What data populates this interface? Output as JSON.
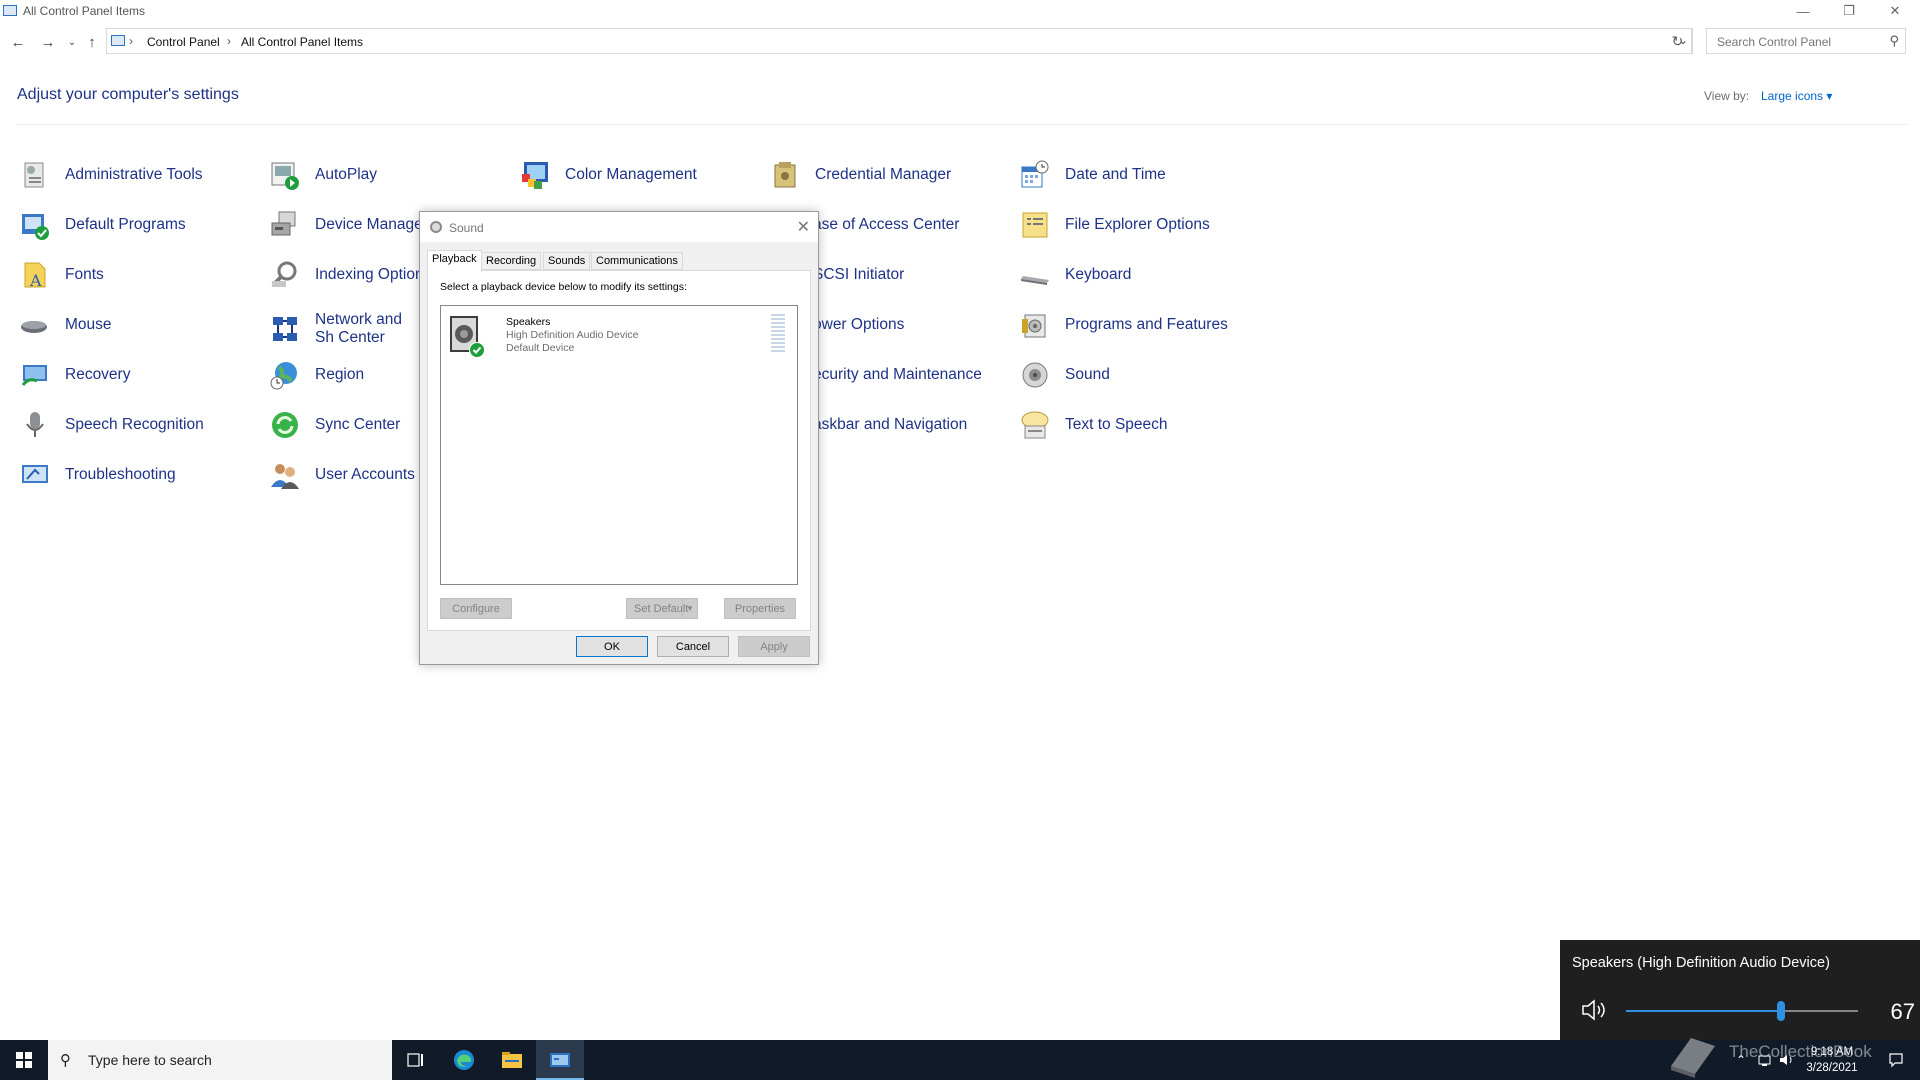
{
  "window": {
    "title": "All Control Panel Items"
  },
  "address": {
    "breadcrumbs": [
      "Control Panel",
      "All Control Panel Items"
    ],
    "search_placeholder": "Search Control Panel"
  },
  "header": {
    "heading": "Adjust your computer's settings",
    "view_by_label": "View by:",
    "view_by_value": "Large icons"
  },
  "items": {
    "administrative_tools": "Administrative Tools",
    "autoplay": "AutoPlay",
    "color_management": "Color Management",
    "credential_manager": "Credential Manager",
    "date_and_time": "Date and Time",
    "default_programs": "Default Programs",
    "device_manager": "Device Manage",
    "ease_of_access": "ase of Access Center",
    "file_explorer_options": "File Explorer Options",
    "fonts": "Fonts",
    "indexing_options": "Indexing Option",
    "iscsi_initiator": "SCSI Initiator",
    "keyboard": "Keyboard",
    "mouse": "Mouse",
    "network_and_sharing": "Network and Sh Center",
    "power_options": "ower Options",
    "programs_and_features": "Programs and Features",
    "recovery": "Recovery",
    "region": "Region",
    "security_and_maintenance": "ecurity and Maintenance",
    "sound": "Sound",
    "speech_recognition": "Speech Recognition",
    "sync_center": "Sync Center",
    "taskbar_and_navigation": "askbar and Navigation",
    "text_to_speech": "Text to Speech",
    "troubleshooting": "Troubleshooting",
    "user_accounts": "User Accounts"
  },
  "dialog": {
    "title": "Sound",
    "tabs": [
      "Playback",
      "Recording",
      "Sounds",
      "Communications"
    ],
    "instruction": "Select a playback device below to modify its settings:",
    "device": {
      "name": "Speakers",
      "description": "High Definition Audio Device",
      "status": "Default Device"
    },
    "buttons": {
      "configure": "Configure",
      "set_default": "Set Default",
      "properties": "Properties",
      "ok": "OK",
      "cancel": "Cancel",
      "apply": "Apply"
    }
  },
  "volume_flyout": {
    "device": "Speakers (High Definition Audio Device)",
    "level": "67",
    "level_fraction": 0.67
  },
  "taskbar": {
    "search_placeholder": "Type here to search",
    "time": "9:18 AM",
    "date": "3/28/2021"
  },
  "watermark": {
    "text": "TheCollectionBook"
  },
  "colors": {
    "link": "#1e3287",
    "accent": "#0078d7",
    "taskbar": "#101a28",
    "flyout": "#1f1f1f"
  }
}
